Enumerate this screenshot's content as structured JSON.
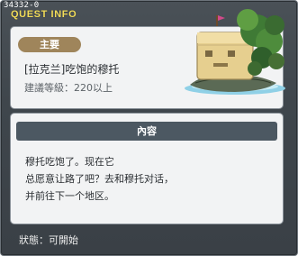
{
  "window": {
    "quest_id": "34332-0",
    "title": "QUEST INFO"
  },
  "quest": {
    "type_tag": "主要",
    "name": "[拉克兰]吃饱的穆托",
    "level_requirement": "建議等級：220以上"
  },
  "content": {
    "header": "內容",
    "lines": [
      "穆托吃饱了。现在它",
      "总愿意让路了吧？去和穆托对话，",
      "并前往下一个地区。"
    ]
  },
  "status": {
    "text": "狀態：可開始"
  },
  "icons": {
    "illustration": "floating-island-stone-face-icon"
  },
  "colors": {
    "title": "#f2dd5a",
    "tag": "#9f855b",
    "section_header": "#4c5862",
    "panel_bg": "#3f464c"
  }
}
